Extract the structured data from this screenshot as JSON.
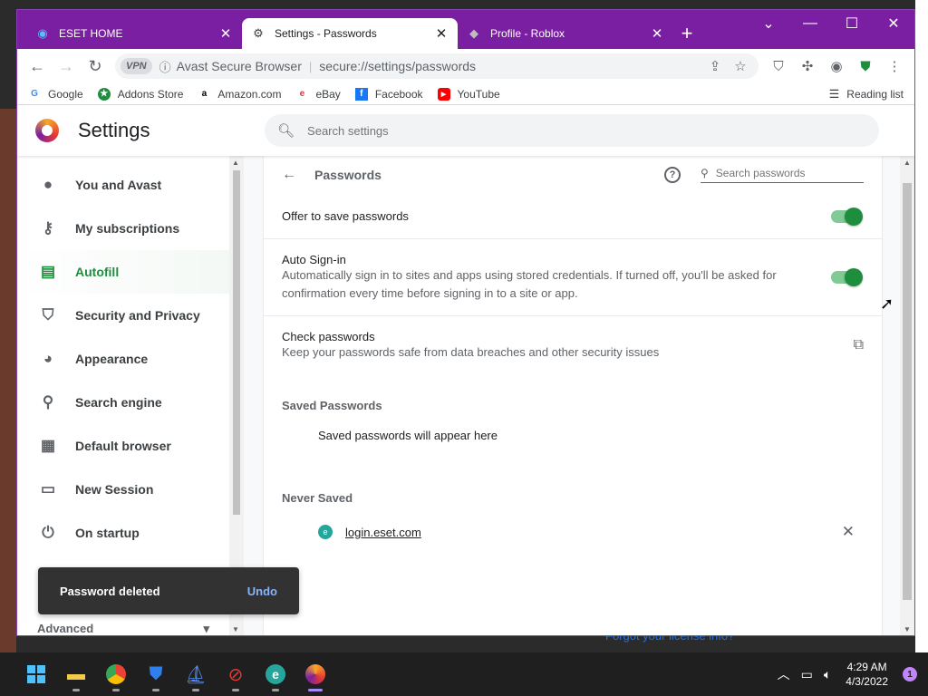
{
  "tabs": [
    {
      "title": "ESET HOME",
      "icon": "eset-icon",
      "active": false
    },
    {
      "title": "Settings - Passwords",
      "icon": "gear-icon",
      "active": true
    },
    {
      "title": "Profile - Roblox",
      "icon": "roblox-icon",
      "active": false
    }
  ],
  "toolbar": {
    "vpn_label": "VPN",
    "site_name": "Avast Secure Browser",
    "url": "secure://settings/passwords"
  },
  "bookmarks": [
    {
      "label": "Google",
      "icon": "G",
      "color": "#4285f4"
    },
    {
      "label": "Addons Store",
      "icon": "★",
      "color": "#1e8e3e"
    },
    {
      "label": "Amazon.com",
      "icon": "a",
      "color": "#000000"
    },
    {
      "label": "eBay",
      "icon": "e",
      "color": "#e53238"
    },
    {
      "label": "Facebook",
      "icon": "f",
      "color": "#1877f2"
    },
    {
      "label": "YouTube",
      "icon": "▶",
      "color": "#ff0000"
    }
  ],
  "reading_list_label": "Reading list",
  "settings": {
    "title": "Settings",
    "search_placeholder": "Search settings"
  },
  "sidebar": {
    "items": [
      {
        "label": "You and Avast",
        "icon": "person-icon",
        "active": false
      },
      {
        "label": "My subscriptions",
        "icon": "key-icon",
        "active": false
      },
      {
        "label": "Autofill",
        "icon": "clipboard-icon",
        "active": true
      },
      {
        "label": "Security and Privacy",
        "icon": "shield-icon",
        "active": false
      },
      {
        "label": "Appearance",
        "icon": "palette-icon",
        "active": false
      },
      {
        "label": "Search engine",
        "icon": "search-icon",
        "active": false
      },
      {
        "label": "Default browser",
        "icon": "browser-icon",
        "active": false
      },
      {
        "label": "New Session",
        "icon": "window-icon",
        "active": false
      },
      {
        "label": "On startup",
        "icon": "power-icon",
        "active": false
      }
    ],
    "advanced_label": "Advanced"
  },
  "passwords": {
    "title": "Passwords",
    "search_placeholder": "Search passwords",
    "offer_to_save_label": "Offer to save passwords",
    "offer_to_save_enabled": true,
    "auto_signin_label": "Auto Sign-in",
    "auto_signin_desc": "Automatically sign in to sites and apps using stored credentials. If turned off, you'll be asked for confirmation every time before signing in to a site or app.",
    "auto_signin_enabled": true,
    "check_label": "Check passwords",
    "check_desc": "Keep your passwords safe from data breaches and other security issues",
    "saved_title": "Saved Passwords",
    "saved_empty": "Saved passwords will appear here",
    "never_title": "Never Saved",
    "never_saved": [
      {
        "site": "login.eset.com"
      }
    ]
  },
  "toast": {
    "message": "Password deleted",
    "action": "Undo"
  },
  "background_link": "Forgot your license info?",
  "taskbar": {
    "time": "4:29 AM",
    "date": "4/3/2022",
    "notification_count": "1"
  }
}
